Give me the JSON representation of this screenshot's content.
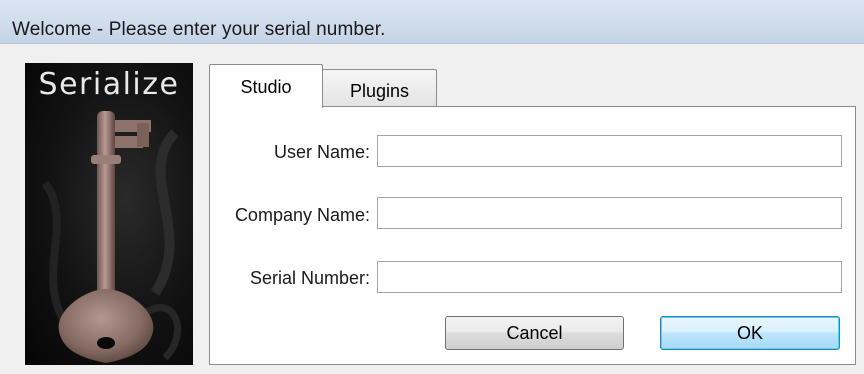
{
  "window": {
    "title": "Welcome - Please enter your serial number."
  },
  "side_image": {
    "title": "Serialize",
    "picture": "antique-key"
  },
  "tabs": [
    {
      "label": "Studio",
      "selected": true
    },
    {
      "label": "Plugins",
      "selected": false
    }
  ],
  "form": {
    "user_name": {
      "label": "User Name:",
      "value": ""
    },
    "company_name": {
      "label": "Company Name:",
      "value": ""
    },
    "serial_number": {
      "label": "Serial Number:",
      "value": ""
    }
  },
  "buttons": {
    "cancel": "Cancel",
    "ok": "OK"
  },
  "colors": {
    "titlebar": "#cfdcec",
    "ok_border": "#3c7fb1",
    "panel_background": "#ffffff"
  }
}
